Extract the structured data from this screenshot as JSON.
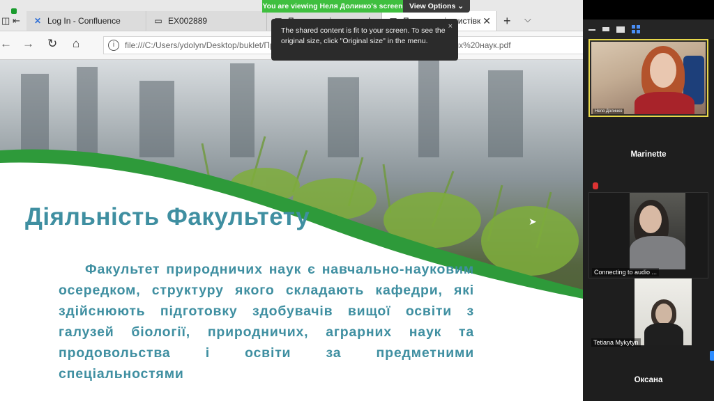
{
  "browser": {
    "tabs": [
      {
        "label": "Log In - Confluence",
        "icon": "confluence-icon"
      },
      {
        "label": "EX002889",
        "icon": "page-icon"
      },
      {
        "label": "Презентація випуск ф",
        "icon": "pdf-icon"
      },
      {
        "label": "Презентація листівк",
        "icon": "pdf-icon"
      }
    ],
    "new_tab": "+",
    "tab_list": "⌵",
    "url": "file:///C:/Users/ydolyn/Desktop/buklet/Пре",
    "url_tail": "иродничих%20наук.pdf"
  },
  "zoom": {
    "viewing_banner": "You are viewing Неля Долинко's screen",
    "view_options": "View Options",
    "tooltip": "The shared content is fit to your screen. To see the original size, click \"Original size\" in the menu.",
    "tooltip_close": "×",
    "participants": [
      {
        "name": "Неля Долинко",
        "video": true
      },
      {
        "name": "Marinette",
        "video": false
      },
      {
        "name": "Connecting to audio ...",
        "video": true
      },
      {
        "name": "Tetiana Mykytyn",
        "video": true
      },
      {
        "name": "Оксана",
        "video": false
      }
    ]
  },
  "slide": {
    "title": "Діяльність Факультету",
    "body": "Факультет природничих наук є навчально-науковим осередком, структуру якого складають кафедри, які здійснюють підготовку здобувачів вищої освіти з галузей біології, природничих, аграрних наук та продовольства і освіти за предметними спеціальностями"
  },
  "colors": {
    "title": "#3f8fa1",
    "wave_green": "#2e9a3a",
    "zoom_green": "#3fbf3f",
    "active_speaker": "#e8d84a"
  }
}
